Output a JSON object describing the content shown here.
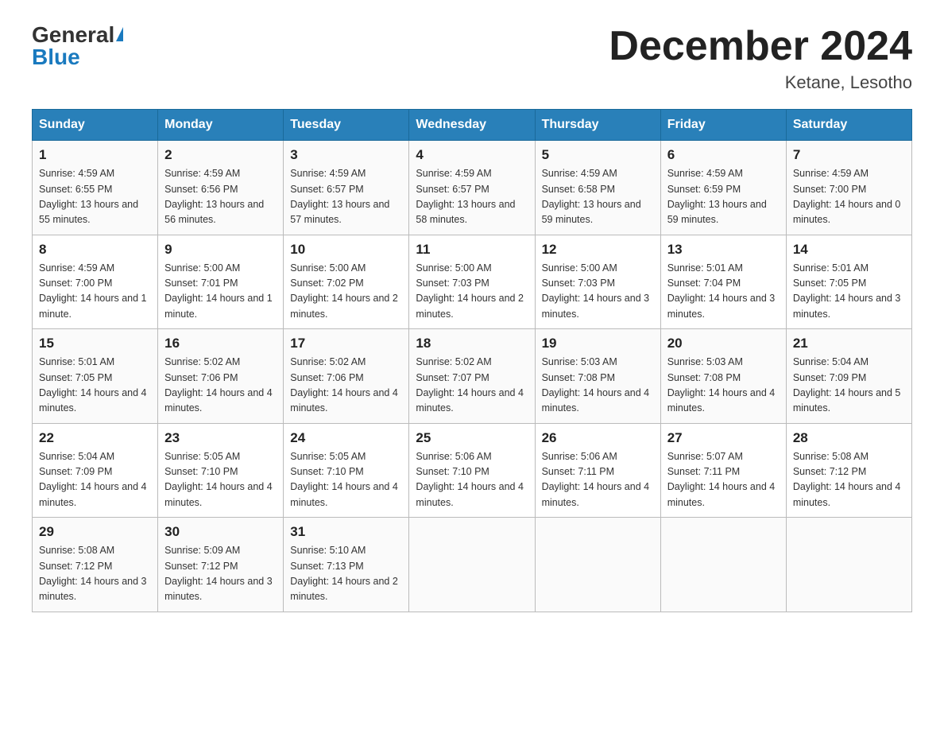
{
  "header": {
    "logo_general": "General",
    "logo_blue": "Blue",
    "month_title": "December 2024",
    "location": "Ketane, Lesotho"
  },
  "days_of_week": [
    "Sunday",
    "Monday",
    "Tuesday",
    "Wednesday",
    "Thursday",
    "Friday",
    "Saturday"
  ],
  "weeks": [
    [
      {
        "day": "1",
        "sunrise": "Sunrise: 4:59 AM",
        "sunset": "Sunset: 6:55 PM",
        "daylight": "Daylight: 13 hours and 55 minutes."
      },
      {
        "day": "2",
        "sunrise": "Sunrise: 4:59 AM",
        "sunset": "Sunset: 6:56 PM",
        "daylight": "Daylight: 13 hours and 56 minutes."
      },
      {
        "day": "3",
        "sunrise": "Sunrise: 4:59 AM",
        "sunset": "Sunset: 6:57 PM",
        "daylight": "Daylight: 13 hours and 57 minutes."
      },
      {
        "day": "4",
        "sunrise": "Sunrise: 4:59 AM",
        "sunset": "Sunset: 6:57 PM",
        "daylight": "Daylight: 13 hours and 58 minutes."
      },
      {
        "day": "5",
        "sunrise": "Sunrise: 4:59 AM",
        "sunset": "Sunset: 6:58 PM",
        "daylight": "Daylight: 13 hours and 59 minutes."
      },
      {
        "day": "6",
        "sunrise": "Sunrise: 4:59 AM",
        "sunset": "Sunset: 6:59 PM",
        "daylight": "Daylight: 13 hours and 59 minutes."
      },
      {
        "day": "7",
        "sunrise": "Sunrise: 4:59 AM",
        "sunset": "Sunset: 7:00 PM",
        "daylight": "Daylight: 14 hours and 0 minutes."
      }
    ],
    [
      {
        "day": "8",
        "sunrise": "Sunrise: 4:59 AM",
        "sunset": "Sunset: 7:00 PM",
        "daylight": "Daylight: 14 hours and 1 minute."
      },
      {
        "day": "9",
        "sunrise": "Sunrise: 5:00 AM",
        "sunset": "Sunset: 7:01 PM",
        "daylight": "Daylight: 14 hours and 1 minute."
      },
      {
        "day": "10",
        "sunrise": "Sunrise: 5:00 AM",
        "sunset": "Sunset: 7:02 PM",
        "daylight": "Daylight: 14 hours and 2 minutes."
      },
      {
        "day": "11",
        "sunrise": "Sunrise: 5:00 AM",
        "sunset": "Sunset: 7:03 PM",
        "daylight": "Daylight: 14 hours and 2 minutes."
      },
      {
        "day": "12",
        "sunrise": "Sunrise: 5:00 AM",
        "sunset": "Sunset: 7:03 PM",
        "daylight": "Daylight: 14 hours and 3 minutes."
      },
      {
        "day": "13",
        "sunrise": "Sunrise: 5:01 AM",
        "sunset": "Sunset: 7:04 PM",
        "daylight": "Daylight: 14 hours and 3 minutes."
      },
      {
        "day": "14",
        "sunrise": "Sunrise: 5:01 AM",
        "sunset": "Sunset: 7:05 PM",
        "daylight": "Daylight: 14 hours and 3 minutes."
      }
    ],
    [
      {
        "day": "15",
        "sunrise": "Sunrise: 5:01 AM",
        "sunset": "Sunset: 7:05 PM",
        "daylight": "Daylight: 14 hours and 4 minutes."
      },
      {
        "day": "16",
        "sunrise": "Sunrise: 5:02 AM",
        "sunset": "Sunset: 7:06 PM",
        "daylight": "Daylight: 14 hours and 4 minutes."
      },
      {
        "day": "17",
        "sunrise": "Sunrise: 5:02 AM",
        "sunset": "Sunset: 7:06 PM",
        "daylight": "Daylight: 14 hours and 4 minutes."
      },
      {
        "day": "18",
        "sunrise": "Sunrise: 5:02 AM",
        "sunset": "Sunset: 7:07 PM",
        "daylight": "Daylight: 14 hours and 4 minutes."
      },
      {
        "day": "19",
        "sunrise": "Sunrise: 5:03 AM",
        "sunset": "Sunset: 7:08 PM",
        "daylight": "Daylight: 14 hours and 4 minutes."
      },
      {
        "day": "20",
        "sunrise": "Sunrise: 5:03 AM",
        "sunset": "Sunset: 7:08 PM",
        "daylight": "Daylight: 14 hours and 4 minutes."
      },
      {
        "day": "21",
        "sunrise": "Sunrise: 5:04 AM",
        "sunset": "Sunset: 7:09 PM",
        "daylight": "Daylight: 14 hours and 5 minutes."
      }
    ],
    [
      {
        "day": "22",
        "sunrise": "Sunrise: 5:04 AM",
        "sunset": "Sunset: 7:09 PM",
        "daylight": "Daylight: 14 hours and 4 minutes."
      },
      {
        "day": "23",
        "sunrise": "Sunrise: 5:05 AM",
        "sunset": "Sunset: 7:10 PM",
        "daylight": "Daylight: 14 hours and 4 minutes."
      },
      {
        "day": "24",
        "sunrise": "Sunrise: 5:05 AM",
        "sunset": "Sunset: 7:10 PM",
        "daylight": "Daylight: 14 hours and 4 minutes."
      },
      {
        "day": "25",
        "sunrise": "Sunrise: 5:06 AM",
        "sunset": "Sunset: 7:10 PM",
        "daylight": "Daylight: 14 hours and 4 minutes."
      },
      {
        "day": "26",
        "sunrise": "Sunrise: 5:06 AM",
        "sunset": "Sunset: 7:11 PM",
        "daylight": "Daylight: 14 hours and 4 minutes."
      },
      {
        "day": "27",
        "sunrise": "Sunrise: 5:07 AM",
        "sunset": "Sunset: 7:11 PM",
        "daylight": "Daylight: 14 hours and 4 minutes."
      },
      {
        "day": "28",
        "sunrise": "Sunrise: 5:08 AM",
        "sunset": "Sunset: 7:12 PM",
        "daylight": "Daylight: 14 hours and 4 minutes."
      }
    ],
    [
      {
        "day": "29",
        "sunrise": "Sunrise: 5:08 AM",
        "sunset": "Sunset: 7:12 PM",
        "daylight": "Daylight: 14 hours and 3 minutes."
      },
      {
        "day": "30",
        "sunrise": "Sunrise: 5:09 AM",
        "sunset": "Sunset: 7:12 PM",
        "daylight": "Daylight: 14 hours and 3 minutes."
      },
      {
        "day": "31",
        "sunrise": "Sunrise: 5:10 AM",
        "sunset": "Sunset: 7:13 PM",
        "daylight": "Daylight: 14 hours and 2 minutes."
      },
      null,
      null,
      null,
      null
    ]
  ]
}
